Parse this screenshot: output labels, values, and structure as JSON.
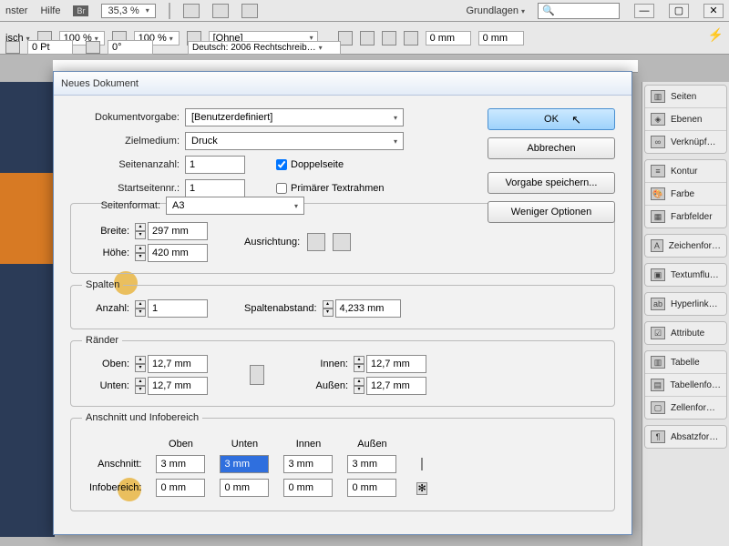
{
  "menu": {
    "fenster": "nster",
    "hilfe": "Hilfe",
    "br": "Br",
    "zoom": "35,3 %",
    "workspace": "Grundlagen"
  },
  "toolbar": {
    "isch": "isch",
    "pct1": "100 %",
    "pct2": "100 %",
    "ohne": "[Ohne]",
    "lang": "Deutsch: 2006 Rechtschreib…",
    "pt": "0 Pt",
    "deg": "0°",
    "mm": "0 mm"
  },
  "panels": {
    "seiten": "Seiten",
    "ebenen": "Ebenen",
    "verk": "Verknüpf…",
    "kontur": "Kontur",
    "farbe": "Farbe",
    "farbfelder": "Farbfelder",
    "zeichen": "Zeichenfor…",
    "textum": "Textumflu…",
    "hyperlink": "Hyperlink…",
    "attribute": "Attribute",
    "tabelle": "Tabelle",
    "tabellen": "Tabellenfo…",
    "zellen": "Zellenfor…",
    "absatz": "Absatzfor…"
  },
  "dialog": {
    "title": "Neues Dokument",
    "labels": {
      "vorgabe": "Dokumentvorgabe:",
      "ziel": "Zielmedium:",
      "seiten": "Seitenanzahl:",
      "start": "Startseitennr.:",
      "doppel": "Doppelseite",
      "primaer": "Primärer Textrahmen",
      "seitenformat": "Seitenformat:",
      "breite": "Breite:",
      "hoehe": "Höhe:",
      "ausrichtung": "Ausrichtung:",
      "spalten": "Spalten",
      "anzahl": "Anzahl:",
      "abstand": "Spaltenabstand:",
      "raender": "Ränder",
      "oben": "Oben:",
      "unten": "Unten:",
      "innen": "Innen:",
      "aussen": "Außen:",
      "anschnitt_t": "Anschnitt und Infobereich",
      "anschnitt": "Anschnitt:",
      "info": "Infobereich:",
      "col_oben": "Oben",
      "col_unten": "Unten",
      "col_innen": "Innen",
      "col_aussen": "Außen"
    },
    "values": {
      "vorgabe": "[Benutzerdefiniert]",
      "ziel": "Druck",
      "seiten": "1",
      "start": "1",
      "format": "A3",
      "breite": "297 mm",
      "hoehe": "420 mm",
      "spalten": "1",
      "abstand": "4,233 mm",
      "m_oben": "12,7 mm",
      "m_unten": "12,7 mm",
      "m_innen": "12,7 mm",
      "m_aussen": "12,7 mm",
      "a_oben": "3 mm",
      "a_unten": "3 mm",
      "a_innen": "3 mm",
      "a_aussen": "3 mm",
      "i_oben": "0 mm",
      "i_unten": "0 mm",
      "i_innen": "0 mm",
      "i_aussen": "0 mm"
    },
    "buttons": {
      "ok": "OK",
      "abbr": "Abbrechen",
      "speichern": "Vorgabe speichern...",
      "weniger": "Weniger Optionen"
    }
  }
}
